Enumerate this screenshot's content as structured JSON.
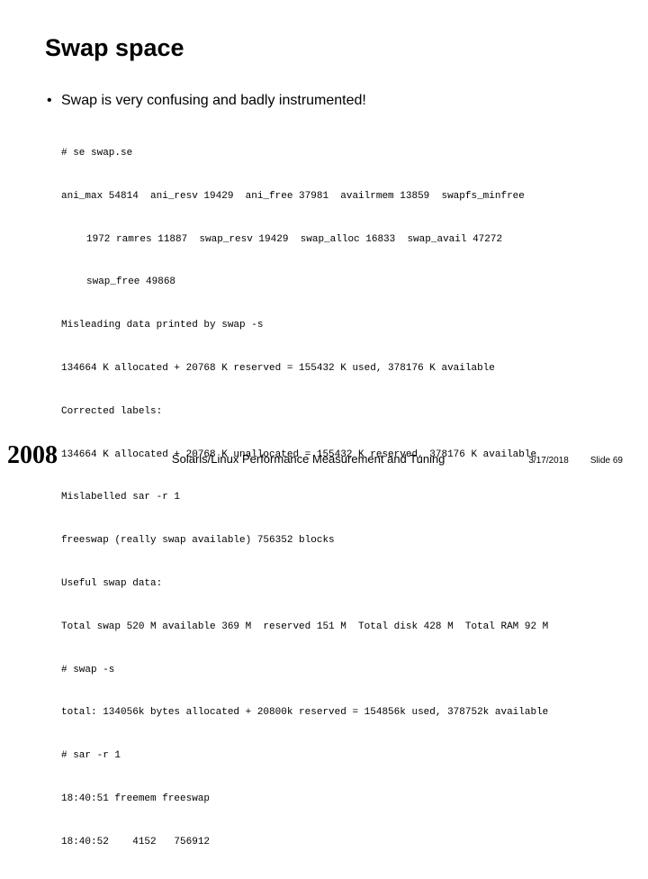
{
  "title": "Swap space",
  "bullet": "Swap is very confusing and badly instrumented!",
  "code": {
    "l01": "# se swap.se",
    "l02a": "ani_max 54814  ani_resv 19429  ani_free 37981  availrmem 13859  swapfs_minfree",
    "l02b": "1972 ramres 11887  swap_resv 19429  swap_alloc 16833  swap_avail 47272",
    "l02c": "swap_free 49868",
    "l03": "Misleading data printed by swap -s",
    "l04": "134664 K allocated + 20768 K reserved = 155432 K used, 378176 K available",
    "l05": "Corrected labels:",
    "l06": "134664 K allocated + 20768 K unallocated = 155432 K reserved, 378176 K available",
    "l07": "Mislabelled sar -r 1",
    "l08": "freeswap (really swap available) 756352 blocks",
    "l09": "Useful swap data:",
    "l10": "Total swap 520 M available 369 M  reserved 151 M  Total disk 428 M  Total RAM 92 M",
    "l11": "# swap -s",
    "l12": "total: 134056k bytes allocated + 20800k reserved = 154856k used, 378752k available",
    "l13": "# sar -r 1",
    "l14": "18:40:51 freemem freeswap",
    "l15": "18:40:52    4152   756912"
  },
  "footer": {
    "year": "2008",
    "title": "Solaris/Linux Performance Measurement and Tuning",
    "date": "3/17/2018",
    "slide": "Slide 69"
  }
}
